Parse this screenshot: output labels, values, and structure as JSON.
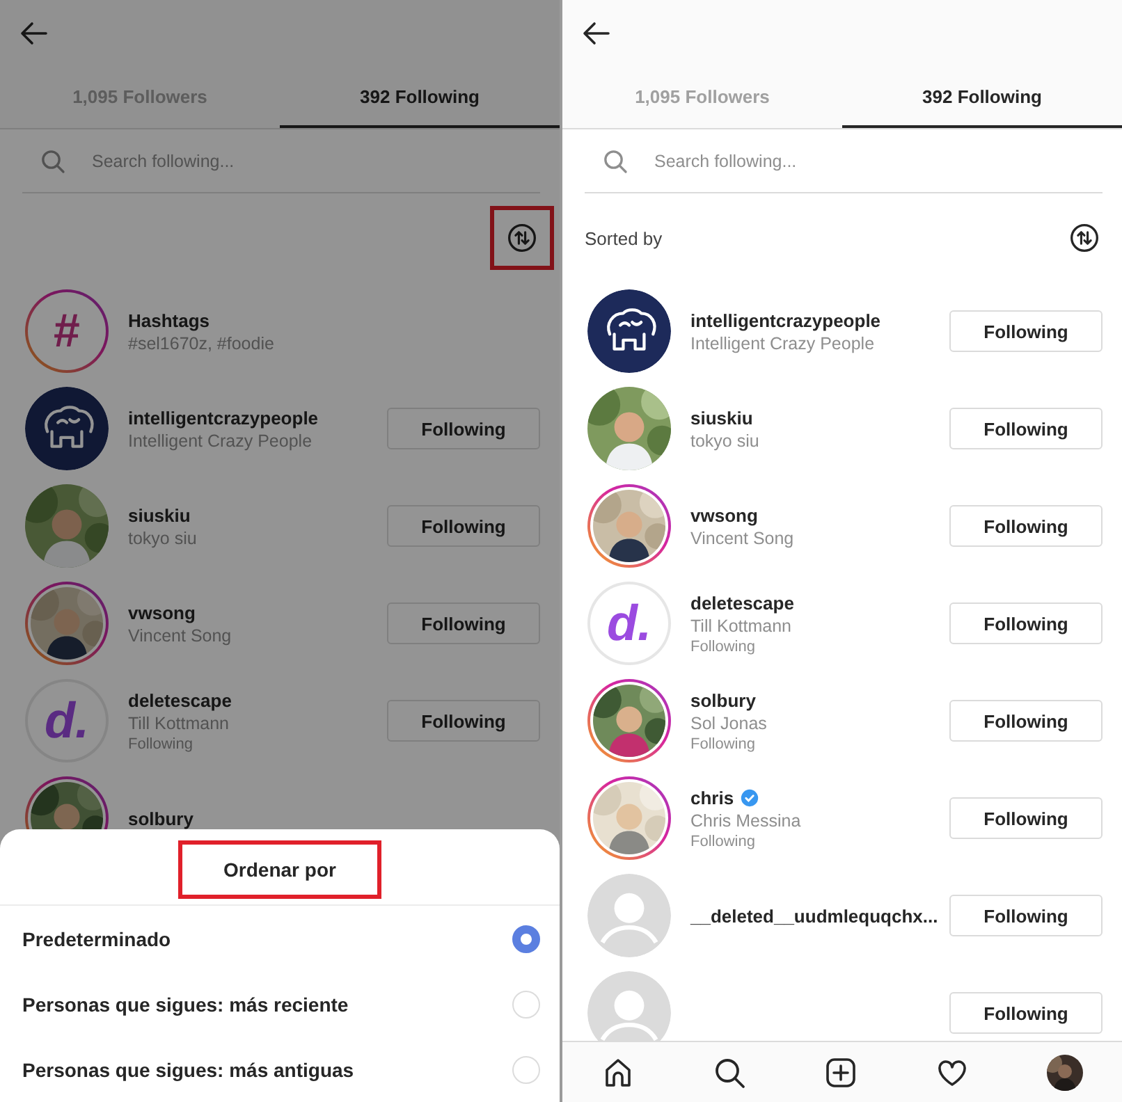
{
  "screens": [
    {
      "dimmed": true,
      "tabs": [
        {
          "label": "1,095 Followers",
          "selected": false
        },
        {
          "label": "392 Following",
          "selected": true
        }
      ],
      "search": {
        "placeholder": "Search following..."
      },
      "sort": {
        "highlighted": true
      },
      "rows": [
        {
          "username": "Hashtags",
          "full_name": "#sel1670z, #foodie",
          "avatar": {
            "kind": "hashtag",
            "text": "#",
            "story_ring": true,
            "seen_ring": false
          }
        },
        {
          "username": "intelligentcrazypeople",
          "full_name": "Intelligent Crazy People",
          "avatar": {
            "kind": "logo",
            "story_ring": false,
            "seen_ring": false
          },
          "button": "Following"
        },
        {
          "username": "siuskiu",
          "full_name": "tokyo siu",
          "avatar": {
            "kind": "picture",
            "story_ring": false,
            "seen_ring": false
          },
          "button": "Following"
        },
        {
          "username": "vwsong",
          "full_name": "Vincent Song",
          "avatar": {
            "kind": "picture",
            "story_ring": true,
            "seen_ring": false
          },
          "button": "Following"
        },
        {
          "username": "deletescape",
          "full_name": "Till Kottmann",
          "note": "Following",
          "avatar": {
            "kind": "letter",
            "text": "d.",
            "story_ring": false,
            "seen_ring": true
          },
          "button": "Following"
        },
        {
          "username": "solbury",
          "avatar": {
            "kind": "picture",
            "story_ring": true,
            "seen_ring": false
          }
        }
      ],
      "sheet": {
        "title": "Ordenar por",
        "title_highlighted": true,
        "options": [
          {
            "label": "Predeterminado",
            "selected": true
          },
          {
            "label": "Personas que sigues: más reciente",
            "selected": false
          },
          {
            "label": "Personas que sigues: más antiguas",
            "selected": false
          }
        ]
      }
    },
    {
      "tabs": [
        {
          "label": "1,095 Followers",
          "selected": false
        },
        {
          "label": "392 Following",
          "selected": true
        }
      ],
      "search": {
        "placeholder": "Search following..."
      },
      "sort": {
        "label": "Sorted by",
        "highlighted": false
      },
      "rows": [
        {
          "username": "intelligentcrazypeople",
          "full_name": "Intelligent Crazy People",
          "avatar": {
            "kind": "logo",
            "story_ring": false,
            "seen_ring": false
          },
          "button": "Following"
        },
        {
          "username": "siuskiu",
          "full_name": "tokyo siu",
          "avatar": {
            "kind": "picture",
            "story_ring": false,
            "seen_ring": false
          },
          "button": "Following"
        },
        {
          "username": "vwsong",
          "full_name": "Vincent Song",
          "avatar": {
            "kind": "picture",
            "story_ring": true,
            "seen_ring": false
          },
          "button": "Following"
        },
        {
          "username": "deletescape",
          "full_name": "Till Kottmann",
          "note": "Following",
          "avatar": {
            "kind": "letter",
            "text": "d.",
            "story_ring": false,
            "seen_ring": true
          },
          "button": "Following"
        },
        {
          "username": "solbury",
          "full_name": "Sol Jonas",
          "note": "Following",
          "avatar": {
            "kind": "picture",
            "story_ring": true,
            "seen_ring": false
          },
          "button": "Following"
        },
        {
          "username": "chris",
          "verified": true,
          "full_name": "Chris Messina",
          "note": "Following",
          "avatar": {
            "kind": "picture",
            "story_ring": true,
            "seen_ring": false
          },
          "button": "Following"
        },
        {
          "username": "__deleted__uudmlequqchx...",
          "avatar": {
            "kind": "placeholder",
            "story_ring": false,
            "seen_ring": false
          },
          "button": "Following"
        },
        {
          "avatar": {
            "kind": "placeholder",
            "story_ring": false,
            "seen_ring": false
          },
          "button": "Following"
        }
      ],
      "bottom_nav": [
        {
          "kind": "home"
        },
        {
          "kind": "search"
        },
        {
          "kind": "add"
        },
        {
          "kind": "heart"
        },
        {
          "kind": "profile"
        }
      ]
    }
  ]
}
